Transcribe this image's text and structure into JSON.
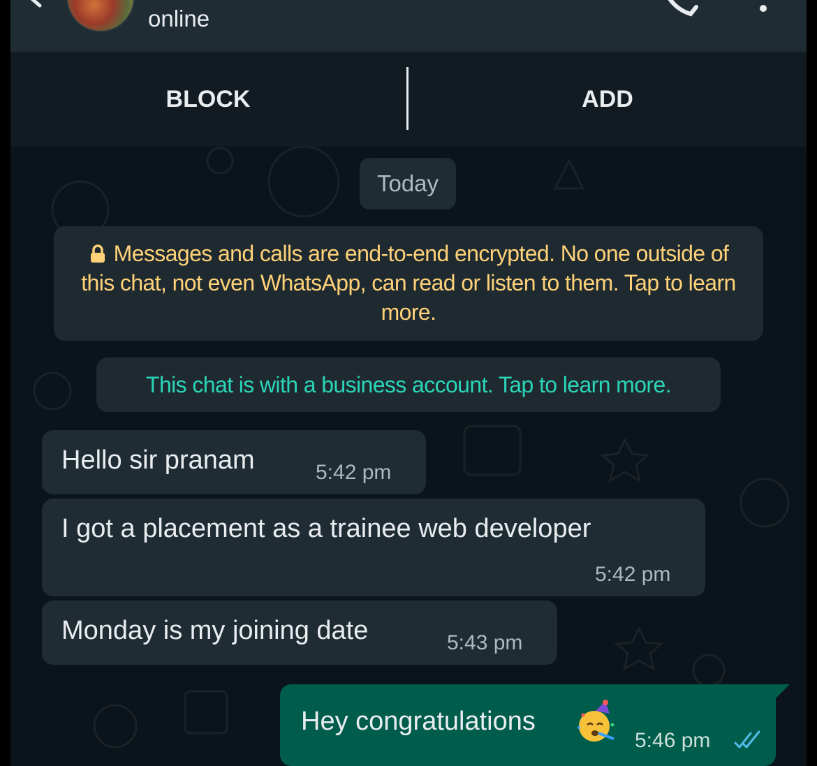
{
  "header": {
    "status": "online"
  },
  "actions": {
    "block_label": "BLOCK",
    "add_label": "ADD"
  },
  "date_chip": "Today",
  "notices": {
    "encryption": "Messages and calls are end-to-end encrypted. No one outside of this chat, not even WhatsApp, can read or listen to them. Tap to learn more.",
    "business": "This chat is with a business account. Tap to learn more."
  },
  "messages": [
    {
      "direction": "incoming",
      "text": "Hello sir pranam",
      "time": "5:42 pm"
    },
    {
      "direction": "incoming",
      "text": "I got a placement as a trainee web developer",
      "time": "5:42 pm"
    },
    {
      "direction": "incoming",
      "text": "Monday is my joining date",
      "time": "5:43 pm"
    },
    {
      "direction": "outgoing",
      "text": "Hey congratulations",
      "time": "5:46 pm",
      "status": "read",
      "emoji": "partying-face"
    }
  ],
  "icons": {
    "back": "arrow-left-icon",
    "call": "phone-icon",
    "menu": "more-vertical-icon",
    "lock": "lock-icon",
    "read_status": "double-check-icon"
  },
  "colors": {
    "background": "#0b141a",
    "header": "#1f2c34",
    "incoming_bubble": "#1f2c34",
    "outgoing_bubble": "#005c4b",
    "encryption_text": "#ffd279",
    "business_text": "#2bd5b8",
    "read_ticks": "#53bdeb"
  }
}
